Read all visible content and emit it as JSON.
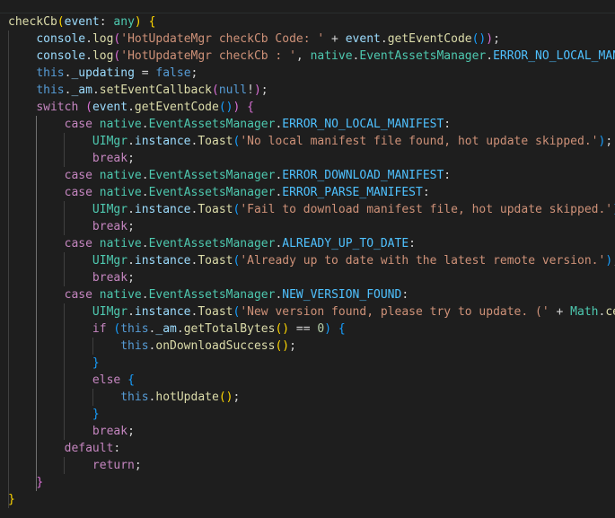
{
  "lines": [
    [
      [
        "fn",
        "checkCb"
      ],
      [
        "b1",
        "("
      ],
      [
        "var",
        "event"
      ],
      [
        "pun",
        ": "
      ],
      [
        "typ",
        "any"
      ],
      [
        "b1",
        ")"
      ],
      [
        "pun",
        " "
      ],
      [
        "b1",
        "{"
      ]
    ],
    [
      [
        "pun",
        "    "
      ],
      [
        "var",
        "console"
      ],
      [
        "pun",
        "."
      ],
      [
        "fn",
        "log"
      ],
      [
        "b2",
        "("
      ],
      [
        "str",
        "'HotUpdateMgr checkCb Code: '"
      ],
      [
        "pun",
        " + "
      ],
      [
        "var",
        "event"
      ],
      [
        "pun",
        "."
      ],
      [
        "fn",
        "getEventCode"
      ],
      [
        "b3",
        "()"
      ],
      [
        "b2",
        ")"
      ],
      [
        "pun",
        ";"
      ]
    ],
    [
      [
        "pun",
        "    "
      ],
      [
        "var",
        "console"
      ],
      [
        "pun",
        "."
      ],
      [
        "fn",
        "log"
      ],
      [
        "b2",
        "("
      ],
      [
        "str",
        "'HotUpdateMgr checkCb : '"
      ],
      [
        "pun",
        ", "
      ],
      [
        "typ",
        "native"
      ],
      [
        "pun",
        "."
      ],
      [
        "typ",
        "EventAssetsManager"
      ],
      [
        "pun",
        "."
      ],
      [
        "cst",
        "ERROR_NO_LOCAL_MANIFEST"
      ],
      [
        "b2",
        ")"
      ],
      [
        "pun",
        ";"
      ]
    ],
    [
      [
        "pun",
        "    "
      ],
      [
        "kw",
        "this"
      ],
      [
        "pun",
        "."
      ],
      [
        "var",
        "_updating"
      ],
      [
        "pun",
        " = "
      ],
      [
        "kw",
        "false"
      ],
      [
        "pun",
        ";"
      ]
    ],
    [
      [
        "pun",
        "    "
      ],
      [
        "kw",
        "this"
      ],
      [
        "pun",
        "."
      ],
      [
        "var",
        "_am"
      ],
      [
        "pun",
        "."
      ],
      [
        "fn",
        "setEventCallback"
      ],
      [
        "b2",
        "("
      ],
      [
        "kw",
        "null"
      ],
      [
        "pun",
        "!"
      ],
      [
        "b2",
        ")"
      ],
      [
        "pun",
        ";"
      ]
    ],
    [
      [
        "pun",
        "    "
      ],
      [
        "ctl",
        "switch"
      ],
      [
        "pun",
        " "
      ],
      [
        "b2",
        "("
      ],
      [
        "var",
        "event"
      ],
      [
        "pun",
        "."
      ],
      [
        "fn",
        "getEventCode"
      ],
      [
        "b3",
        "()"
      ],
      [
        "b2",
        ")"
      ],
      [
        "pun",
        " "
      ],
      [
        "b2",
        "{"
      ]
    ],
    [
      [
        "pun",
        "        "
      ],
      [
        "ctl",
        "case"
      ],
      [
        "pun",
        " "
      ],
      [
        "typ",
        "native"
      ],
      [
        "pun",
        "."
      ],
      [
        "typ",
        "EventAssetsManager"
      ],
      [
        "pun",
        "."
      ],
      [
        "cst",
        "ERROR_NO_LOCAL_MANIFEST"
      ],
      [
        "pun",
        ":"
      ]
    ],
    [
      [
        "pun",
        "            "
      ],
      [
        "typ",
        "UIMgr"
      ],
      [
        "pun",
        "."
      ],
      [
        "var",
        "instance"
      ],
      [
        "pun",
        "."
      ],
      [
        "fn",
        "Toast"
      ],
      [
        "b3",
        "("
      ],
      [
        "str",
        "'No local manifest file found, hot update skipped.'"
      ],
      [
        "b3",
        ")"
      ],
      [
        "pun",
        ";"
      ]
    ],
    [
      [
        "pun",
        "            "
      ],
      [
        "ctl",
        "break"
      ],
      [
        "pun",
        ";"
      ]
    ],
    [
      [
        "pun",
        "        "
      ],
      [
        "ctl",
        "case"
      ],
      [
        "pun",
        " "
      ],
      [
        "typ",
        "native"
      ],
      [
        "pun",
        "."
      ],
      [
        "typ",
        "EventAssetsManager"
      ],
      [
        "pun",
        "."
      ],
      [
        "cst",
        "ERROR_DOWNLOAD_MANIFEST"
      ],
      [
        "pun",
        ":"
      ]
    ],
    [
      [
        "pun",
        "        "
      ],
      [
        "ctl",
        "case"
      ],
      [
        "pun",
        " "
      ],
      [
        "typ",
        "native"
      ],
      [
        "pun",
        "."
      ],
      [
        "typ",
        "EventAssetsManager"
      ],
      [
        "pun",
        "."
      ],
      [
        "cst",
        "ERROR_PARSE_MANIFEST"
      ],
      [
        "pun",
        ":"
      ]
    ],
    [
      [
        "pun",
        "            "
      ],
      [
        "typ",
        "UIMgr"
      ],
      [
        "pun",
        "."
      ],
      [
        "var",
        "instance"
      ],
      [
        "pun",
        "."
      ],
      [
        "fn",
        "Toast"
      ],
      [
        "b3",
        "("
      ],
      [
        "str",
        "'Fail to download manifest file, hot update skipped.'"
      ],
      [
        "b3",
        ")"
      ],
      [
        "pun",
        ";"
      ]
    ],
    [
      [
        "pun",
        "            "
      ],
      [
        "ctl",
        "break"
      ],
      [
        "pun",
        ";"
      ]
    ],
    [
      [
        "pun",
        "        "
      ],
      [
        "ctl",
        "case"
      ],
      [
        "pun",
        " "
      ],
      [
        "typ",
        "native"
      ],
      [
        "pun",
        "."
      ],
      [
        "typ",
        "EventAssetsManager"
      ],
      [
        "pun",
        "."
      ],
      [
        "cst",
        "ALREADY_UP_TO_DATE"
      ],
      [
        "pun",
        ":"
      ]
    ],
    [
      [
        "pun",
        "            "
      ],
      [
        "typ",
        "UIMgr"
      ],
      [
        "pun",
        "."
      ],
      [
        "var",
        "instance"
      ],
      [
        "pun",
        "."
      ],
      [
        "fn",
        "Toast"
      ],
      [
        "b3",
        "("
      ],
      [
        "str",
        "'Already up to date with the latest remote version.'"
      ],
      [
        "b3",
        ")"
      ],
      [
        "pun",
        ";"
      ]
    ],
    [
      [
        "pun",
        "            "
      ],
      [
        "ctl",
        "break"
      ],
      [
        "pun",
        ";"
      ]
    ],
    [
      [
        "pun",
        "        "
      ],
      [
        "ctl",
        "case"
      ],
      [
        "pun",
        " "
      ],
      [
        "typ",
        "native"
      ],
      [
        "pun",
        "."
      ],
      [
        "typ",
        "EventAssetsManager"
      ],
      [
        "pun",
        "."
      ],
      [
        "cst",
        "NEW_VERSION_FOUND"
      ],
      [
        "pun",
        ":"
      ]
    ],
    [
      [
        "pun",
        "            "
      ],
      [
        "typ",
        "UIMgr"
      ],
      [
        "pun",
        "."
      ],
      [
        "var",
        "instance"
      ],
      [
        "pun",
        "."
      ],
      [
        "fn",
        "Toast"
      ],
      [
        "b3",
        "("
      ],
      [
        "str",
        "'New version found, please try to update. ('"
      ],
      [
        "pun",
        " + "
      ],
      [
        "typ",
        "Math"
      ],
      [
        "pun",
        "."
      ],
      [
        "fn",
        "ceil"
      ]
    ],
    [
      [
        "pun",
        "            "
      ],
      [
        "ctl",
        "if"
      ],
      [
        "pun",
        " "
      ],
      [
        "b3",
        "("
      ],
      [
        "kw",
        "this"
      ],
      [
        "pun",
        "."
      ],
      [
        "var",
        "_am"
      ],
      [
        "pun",
        "."
      ],
      [
        "fn",
        "getTotalBytes"
      ],
      [
        "b1",
        "()"
      ],
      [
        "pun",
        " == "
      ],
      [
        "num",
        "0"
      ],
      [
        "b3",
        ")"
      ],
      [
        "pun",
        " "
      ],
      [
        "b3",
        "{"
      ]
    ],
    [
      [
        "pun",
        "                "
      ],
      [
        "kw",
        "this"
      ],
      [
        "pun",
        "."
      ],
      [
        "fn",
        "onDownloadSuccess"
      ],
      [
        "b1",
        "()"
      ],
      [
        "pun",
        ";"
      ]
    ],
    [
      [
        "pun",
        "            "
      ],
      [
        "b3",
        "}"
      ]
    ],
    [
      [
        "pun",
        "            "
      ],
      [
        "ctl",
        "else"
      ],
      [
        "pun",
        " "
      ],
      [
        "b3",
        "{"
      ]
    ],
    [
      [
        "pun",
        "                "
      ],
      [
        "kw",
        "this"
      ],
      [
        "pun",
        "."
      ],
      [
        "fn",
        "hotUpdate"
      ],
      [
        "b1",
        "()"
      ],
      [
        "pun",
        ";"
      ]
    ],
    [
      [
        "pun",
        "            "
      ],
      [
        "b3",
        "}"
      ]
    ],
    [
      [
        "pun",
        "            "
      ],
      [
        "ctl",
        "break"
      ],
      [
        "pun",
        ";"
      ]
    ],
    [
      [
        "pun",
        "        "
      ],
      [
        "ctl",
        "default"
      ],
      [
        "pun",
        ":"
      ]
    ],
    [
      [
        "pun",
        "            "
      ],
      [
        "ctl",
        "return"
      ],
      [
        "pun",
        ";"
      ]
    ],
    [
      [
        "pun",
        "    "
      ],
      [
        "b2",
        "}"
      ]
    ],
    [
      [
        "b1",
        "}"
      ]
    ]
  ]
}
